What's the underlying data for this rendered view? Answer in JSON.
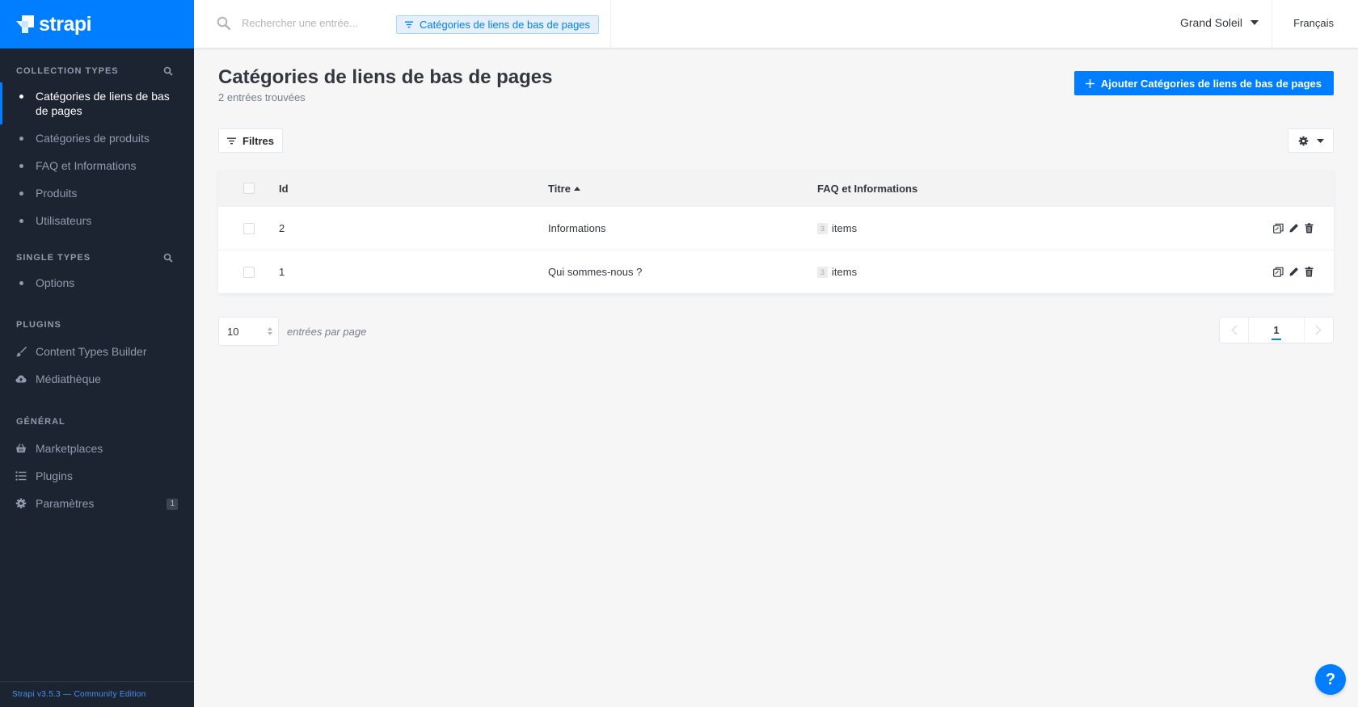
{
  "brand": {
    "name": "strapi"
  },
  "sidebar": {
    "collection_types": {
      "title": "Collection Types",
      "items": [
        {
          "label": "Catégories de liens de bas de pages",
          "active": true
        },
        {
          "label": "Catégories de produits"
        },
        {
          "label": "FAQ et Informations"
        },
        {
          "label": "Produits"
        },
        {
          "label": "Utilisateurs"
        }
      ]
    },
    "single_types": {
      "title": "Single Types",
      "items": [
        {
          "label": "Options"
        }
      ]
    },
    "plugins": {
      "title": "Plugins",
      "items": [
        {
          "label": "Content Types Builder",
          "icon": "paintbrush-icon"
        },
        {
          "label": "Médiathèque",
          "icon": "cloud-upload-icon"
        }
      ]
    },
    "general": {
      "title": "Général",
      "items": [
        {
          "label": "Marketplaces",
          "icon": "basket-icon"
        },
        {
          "label": "Plugins",
          "icon": "list-icon"
        },
        {
          "label": "Paramètres",
          "icon": "gear-icon",
          "badge": "1"
        }
      ]
    },
    "footer": "Strapi v3.5.3 — Community Edition"
  },
  "topbar": {
    "search_placeholder": "Rechercher une entrée...",
    "search_chip": "Catégories de liens de bas de pages",
    "user": "Grand Soleil",
    "language": "Français"
  },
  "page": {
    "title": "Catégories de liens de bas de pages",
    "subtitle": "2 entrées trouvées",
    "add_button": "Ajouter Catégories de liens de bas de pages",
    "filters_button": "Filtres"
  },
  "table": {
    "columns": {
      "id": "Id",
      "title": "Titre",
      "faq": "FAQ et Informations"
    },
    "sort": {
      "column": "Titre",
      "direction": "asc"
    },
    "rows": [
      {
        "id": "2",
        "title": "Informations",
        "faq_count": "3",
        "faq_label": "items"
      },
      {
        "id": "1",
        "title": "Qui sommes-nous ?",
        "faq_count": "3",
        "faq_label": "items"
      }
    ]
  },
  "pagination": {
    "per_page": "10",
    "per_page_label": "entrées par page",
    "current_page": "1"
  },
  "help": {
    "label": "?"
  },
  "colors": {
    "accent": "#007eff",
    "sidebar": "#1c2431"
  }
}
